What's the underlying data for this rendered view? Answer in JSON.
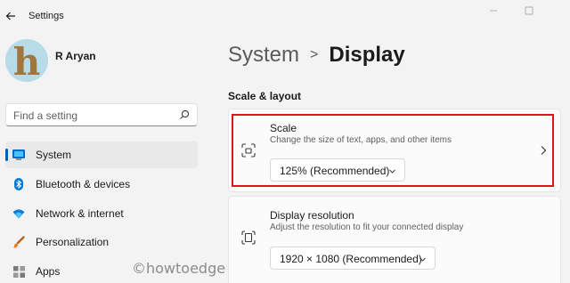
{
  "app": {
    "title": "Settings"
  },
  "user": {
    "name": "R Aryan",
    "avatar_letter": "h"
  },
  "search": {
    "placeholder": "Find a setting"
  },
  "nav": [
    {
      "label": "System",
      "icon": "monitor-icon",
      "active": true
    },
    {
      "label": "Bluetooth & devices",
      "icon": "bluetooth-icon",
      "active": false
    },
    {
      "label": "Network & internet",
      "icon": "wifi-icon",
      "active": false
    },
    {
      "label": "Personalization",
      "icon": "paintbrush-icon",
      "active": false
    },
    {
      "label": "Apps",
      "icon": "apps-icon",
      "active": false
    }
  ],
  "breadcrumb": {
    "parent": "System",
    "separator": ">",
    "current": "Display"
  },
  "section": {
    "heading": "Scale & layout"
  },
  "scale": {
    "title": "Scale",
    "description": "Change the size of text, apps, and other items",
    "value": "125% (Recommended)"
  },
  "resolution": {
    "title": "Display resolution",
    "description": "Adjust the resolution to fit your connected display",
    "value": "1920 × 1080 (Recommended)"
  },
  "watermark": "©howtoedge",
  "colors": {
    "accent": "#005fb8",
    "highlight": "#e0141b",
    "background": "#f3f3f3",
    "card": "#fbfbfb"
  }
}
